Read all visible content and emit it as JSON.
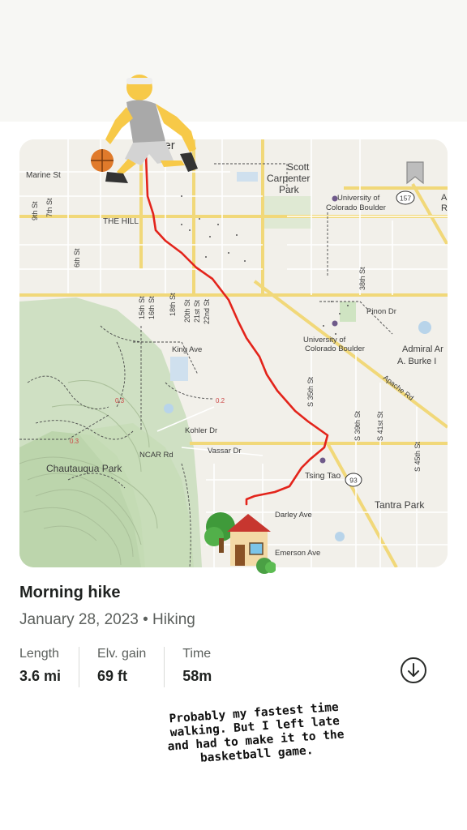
{
  "map": {
    "labels": {
      "boulder": "Boulder",
      "marine_st": "Marine St",
      "scott_carpenter_1": "Scott",
      "scott_carpenter_2": "Carpenter",
      "scott_carpenter_3": "Park",
      "cu_1_a": "University of",
      "cu_1_b": "Colorado Boulder",
      "the_hill": "THE HILL",
      "st_6th": "6th St",
      "st_7th": "7th St",
      "st_9th": "9th St",
      "st_15th": "15th St",
      "st_16th": "16th St",
      "st_18th": "18th St",
      "st_20th": "20th St",
      "st_21st": "21st St",
      "st_22nd": "22nd St",
      "st_38th": "38th St",
      "st_s35th": "S 35th St",
      "st_s39th": "S 39th St",
      "st_s41st": "S 41st St",
      "st_s45th": "S 45th St",
      "chautauqua": "Chautauqua Park",
      "king_ave": "King Ave",
      "cu_2_a": "University of",
      "cu_2_b": "Colorado Boulder",
      "pinon_dr": "Pinon Dr",
      "admiral_1": "Admiral Ar",
      "admiral_2": "A. Burke I",
      "apache_rd": "Apache Rd",
      "kohler_dr": "Kohler Dr",
      "vassar_dr": "Vassar Dr",
      "ncar_rd": "NCAR Rd",
      "tsing_tao": "Tsing Tao",
      "tantra_park": "Tantra Park",
      "darley_ave": "Darley Ave",
      "emerson_ave": "Emerson Ave",
      "route_157": "157",
      "route_93": "93",
      "trail_dist_a": "0.3",
      "trail_dist_b": "0.2",
      "trail_dist_c": "0.3",
      "edge_a": "A",
      "edge_r": "R"
    },
    "route_color": "#e3241b"
  },
  "emojis": {
    "player": "⛹️",
    "house": "🏡"
  },
  "activity": {
    "title": "Morning hike",
    "subtitle": "January 28, 2023 • Hiking"
  },
  "stats": [
    {
      "label": "Length",
      "value": "3.6 mi"
    },
    {
      "label": "Elv. gain",
      "value": "69 ft"
    },
    {
      "label": "Time",
      "value": "58m"
    }
  ],
  "caption_lines": [
    "Probably my fastest time",
    "walking. But I left late",
    "and had to make it to the",
    "basketball game."
  ]
}
